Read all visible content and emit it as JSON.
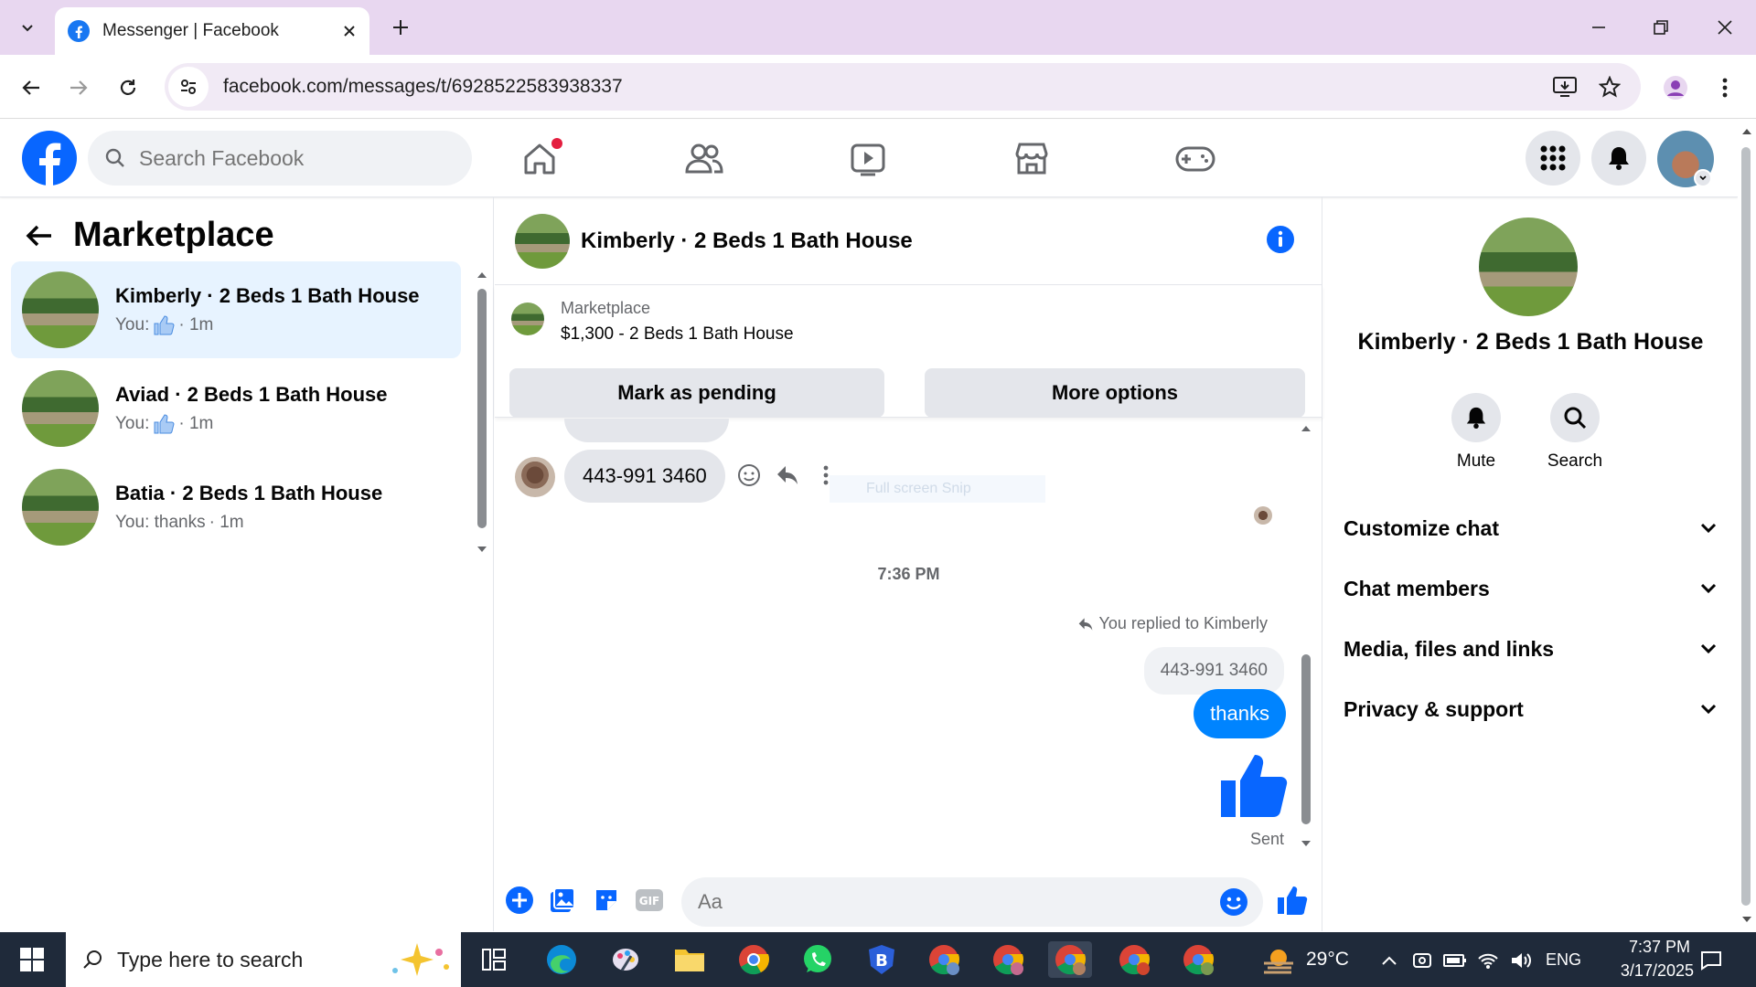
{
  "browser": {
    "tab_title": "Messenger | Facebook",
    "url": "facebook.com/messages/t/6928522583938337"
  },
  "fb": {
    "search_placeholder": "Search Facebook"
  },
  "left": {
    "title": "Marketplace",
    "conversations": [
      {
        "name": "Kimberly · 2 Beds 1 Bath House",
        "prefix": "You:",
        "time": "· 1m",
        "has_like": true
      },
      {
        "name": "Aviad · 2 Beds 1 Bath House",
        "prefix": "You:",
        "time": "· 1m",
        "has_like": true
      },
      {
        "name": "Batia · 2 Beds 1 Bath House",
        "prefix": "You: thanks",
        "time": "· 1m",
        "has_like": false
      }
    ]
  },
  "chat": {
    "title": "Kimberly · 2 Beds 1 Bath House",
    "listing_label": "Marketplace",
    "listing_title": "$1,300 - 2 Beds 1 Bath House",
    "mark_pending": "Mark as pending",
    "more_options": "More options",
    "incoming_message": "443-991 3460",
    "ghost_text": "Full screen Snip",
    "timestamp": "7:36 PM",
    "replied_to": "You replied to Kimberly",
    "quoted": "443-991 3460",
    "outgoing_message": "thanks",
    "status": "Sent",
    "composer_placeholder": "Aa",
    "accent_color": "#0084ff"
  },
  "details": {
    "name": "Kimberly · 2 Beds 1 Bath House",
    "actions": [
      {
        "label": "Mute",
        "icon": "bell-icon"
      },
      {
        "label": "Search",
        "icon": "search-icon"
      }
    ],
    "sections": [
      "Customize chat",
      "Chat members",
      "Media, files and links",
      "Privacy & support"
    ]
  },
  "taskbar": {
    "search_placeholder": "Type here to search",
    "weather": "29°C",
    "language": "ENG",
    "time": "7:37 PM",
    "date": "3/17/2025"
  }
}
